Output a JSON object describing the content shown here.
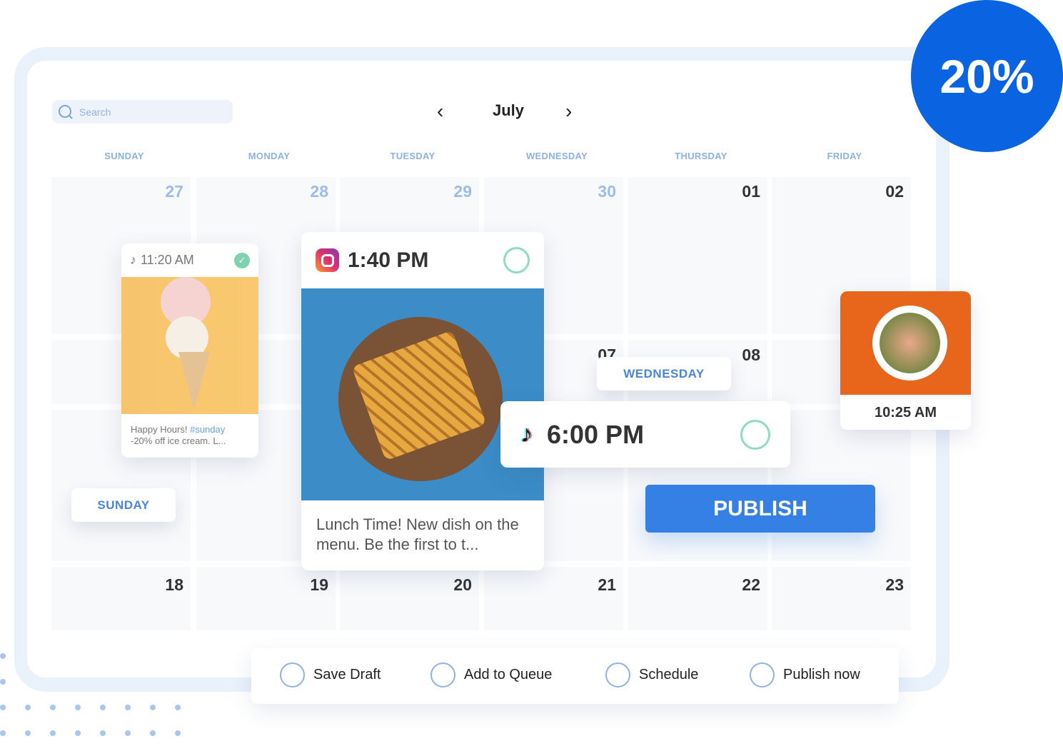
{
  "search": {
    "placeholder": "Search"
  },
  "header": {
    "month": "July",
    "prev_icon": "chevron-left",
    "next_icon": "chevron-right"
  },
  "weekdays": [
    "SUNDAY",
    "MONDAY",
    "TUESDAY",
    "WEDNESDAY",
    "THURSDAY",
    "FRIDAY"
  ],
  "days": {
    "row1": [
      "27",
      "28",
      "29",
      "30",
      "01",
      "02"
    ],
    "row2": [
      "07",
      "08"
    ],
    "row4": [
      "18",
      "19",
      "20",
      "21",
      "22",
      "23"
    ]
  },
  "posts": {
    "icecream": {
      "platform": "tiktok",
      "time": "11:20 AM",
      "caption": "Happy Hours! ",
      "hashtag": "#sunday",
      "caption2": "-20% off ice cream. L...",
      "status": "published"
    },
    "sandwich": {
      "platform": "instagram",
      "time": "1:40 PM",
      "caption": "Lunch Time! New dish on the menu. Be the first to t..."
    },
    "tiktok": {
      "platform": "tiktok",
      "time": "6:00 PM"
    },
    "salad": {
      "time": "10:25 AM"
    }
  },
  "labels": {
    "sunday": "SUNDAY",
    "wednesday": "WEDNESDAY",
    "publish": "PUBLISH"
  },
  "badge": "20%",
  "actions": [
    "Save Draft",
    "Add to Queue",
    "Schedule",
    "Publish now"
  ],
  "colors": {
    "accent": "#3580e4",
    "badge": "#0a63e0",
    "ring": "#8fdcc0"
  }
}
